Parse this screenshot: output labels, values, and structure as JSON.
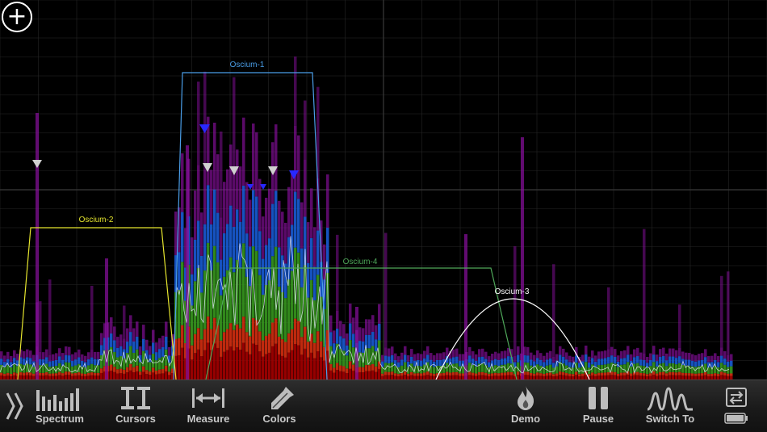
{
  "add_button": {
    "symbol": "+"
  },
  "oscia": [
    {
      "label": "Oscium-1",
      "color": "#4a9ee8"
    },
    {
      "label": "Oscium-2",
      "color": "#e6e62e"
    },
    {
      "label": "Oscium-3",
      "color": "#ffffff"
    },
    {
      "label": "Oscium-4",
      "color": "#4fa85a"
    }
  ],
  "toolbar": {
    "expand_icon": "double-chevron-right-icon",
    "items": [
      {
        "label": "Spectrum",
        "icon": "spectrum-bars-icon"
      },
      {
        "label": "Cursors",
        "icon": "cursors-icon"
      },
      {
        "label": "Measure",
        "icon": "measure-icon"
      },
      {
        "label": "Colors",
        "icon": "eyedropper-icon"
      },
      {
        "label": "Demo",
        "icon": "flame-icon"
      },
      {
        "label": "Pause",
        "icon": "pause-icon"
      },
      {
        "label": "Switch To",
        "icon": "waveform-icon"
      }
    ],
    "switch_icon": "switch-device-icon",
    "battery_icon": "battery-icon"
  },
  "colors": {
    "grid": "#262626",
    "grid_major": "#3a3a3a",
    "heat": [
      "#b00000",
      "#e03010",
      "#3aa020",
      "#1a60e0",
      "#8a10a0"
    ]
  }
}
